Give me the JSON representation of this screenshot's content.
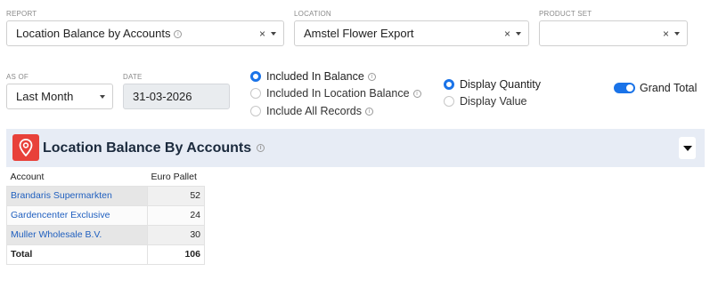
{
  "filters": {
    "report": {
      "label": "REPORT",
      "value": "Location Balance by Accounts",
      "clear_symbol": "×"
    },
    "location": {
      "label": "LOCATION",
      "value": "Amstel Flower Export",
      "clear_symbol": "×"
    },
    "product_set": {
      "label": "PRODUCT SET",
      "value": "",
      "clear_symbol": "×"
    },
    "as_of": {
      "label": "AS OF",
      "value": "Last Month"
    },
    "date": {
      "label": "DATE",
      "value": "31-03-2026"
    }
  },
  "balance_options": [
    {
      "label": "Included In Balance",
      "selected": true
    },
    {
      "label": "Included In Location Balance",
      "selected": false
    },
    {
      "label": "Include All Records",
      "selected": false
    }
  ],
  "display_options": [
    {
      "label": "Display Quantity",
      "selected": true
    },
    {
      "label": "Display Value",
      "selected": false
    }
  ],
  "grand_total": {
    "label": "Grand Total",
    "enabled": true
  },
  "panel": {
    "title": "Location Balance By Accounts",
    "icon": "map-pin-icon",
    "accent_color": "#e8413a"
  },
  "table": {
    "columns": [
      "Account",
      "Euro Pallet"
    ],
    "rows": [
      {
        "account": "Brandaris Supermarkten",
        "euro_pallet": "52"
      },
      {
        "account": "Gardencenter Exclusive",
        "euro_pallet": "24"
      },
      {
        "account": "Muller Wholesale B.V.",
        "euro_pallet": "30"
      }
    ],
    "total": {
      "label": "Total",
      "euro_pallet": "106"
    }
  },
  "colors": {
    "accent": "#1a73e8",
    "link": "#1f5fbf",
    "header_band": "#e7ecf5"
  }
}
